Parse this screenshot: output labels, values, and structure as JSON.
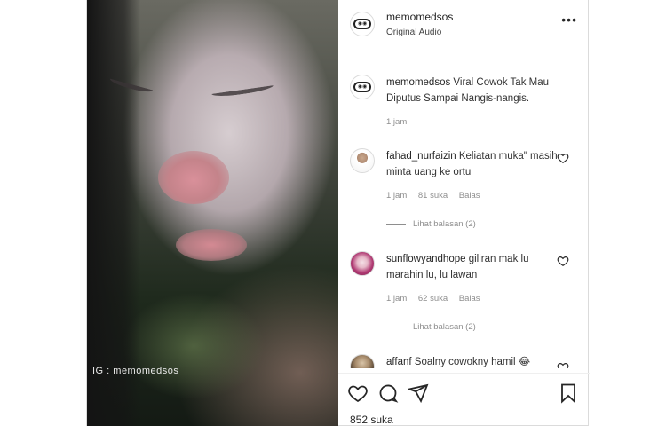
{
  "post": {
    "username": "memomedsos",
    "audio": "Original Audio",
    "more_icon": "more-options-icon",
    "watermark": "IG : memomedsos"
  },
  "caption": {
    "username": "memomedsos",
    "text": "Viral Cowok Tak Mau Diputus Sampai Nangis-nangis.",
    "time": "1 jam"
  },
  "comments": [
    {
      "username": "fahad_nurfaizin",
      "text": "Keliatan muka\" masih minta uang ke ortu",
      "time": "1 jam",
      "likes": "81 suka",
      "reply": "Balas",
      "view_replies": "Lihat balasan (2)"
    },
    {
      "username": "sunflowyandhope",
      "text": "giliran mak lu marahin lu, lu lawan",
      "time": "1 jam",
      "likes": "62 suka",
      "reply": "Balas",
      "view_replies": "Lihat balasan (2)"
    },
    {
      "username": "affanf",
      "text": "Soalny cowokny hamil 😂"
    }
  ],
  "actions": {
    "like_icon": "heart-icon",
    "comment_icon": "comment-icon",
    "share_icon": "share-icon",
    "save_icon": "bookmark-icon"
  },
  "likes_count": "852 suka",
  "colors": {
    "text": "#262626",
    "muted": "#8e8e8e",
    "border": "#dbdbdb"
  }
}
